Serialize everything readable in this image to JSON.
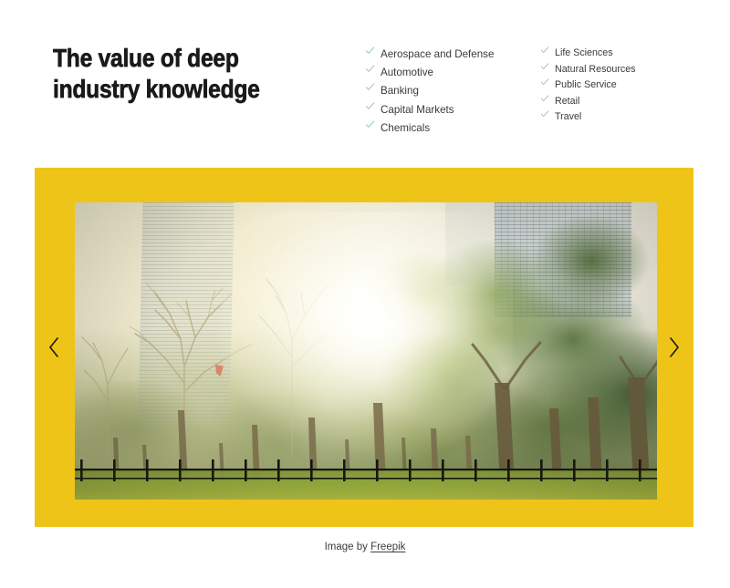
{
  "heading": "The value of deep\nindustry knowledge",
  "industry_lists": {
    "column_one": [
      {
        "icon": "check-icon",
        "label": "Aerospace and Defense"
      },
      {
        "icon": "check-icon",
        "label": "Automotive"
      },
      {
        "icon": "check-icon",
        "label": "Banking"
      },
      {
        "icon": "check-icon",
        "label": "Capital Markets"
      },
      {
        "icon": "check-icon",
        "label": "Chemicals"
      }
    ],
    "column_two": [
      {
        "icon": "check-icon",
        "label": "Life Sciences"
      },
      {
        "icon": "check-icon",
        "label": "Natural Resources"
      },
      {
        "icon": "check-icon",
        "label": "Public Service"
      },
      {
        "icon": "check-icon",
        "label": "Retail"
      },
      {
        "icon": "check-icon",
        "label": "Travel"
      }
    ]
  },
  "slider": {
    "prev_label": "‹",
    "next_label": "›",
    "prev_icon": "chevron-left-icon",
    "next_icon": "chevron-right-icon",
    "photo_alt": "Sunlit city park with trees and skyscrapers"
  },
  "caption": {
    "prefix": "Image by ",
    "link_text": "Freepik"
  },
  "colors": {
    "accent_yellow": "#efc418",
    "heading_text": "#1a1a1a",
    "body_text": "#3a3a3a",
    "check_green": "#9ccb9c",
    "page_background": "#ffffff"
  }
}
